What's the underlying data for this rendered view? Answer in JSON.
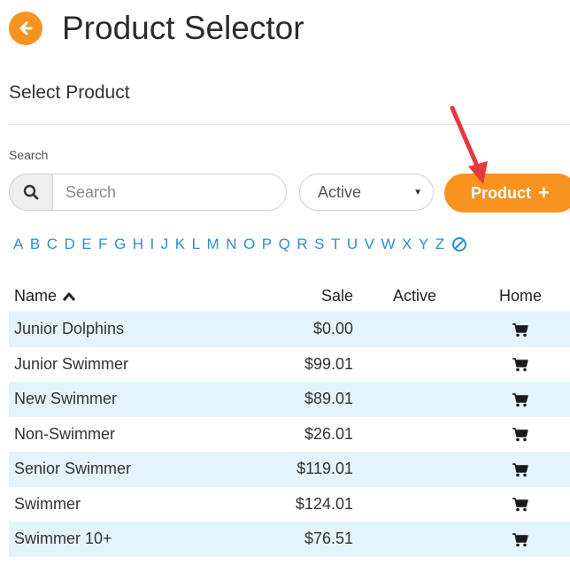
{
  "header": {
    "title": "Product Selector",
    "back_icon": "arrow-left-icon",
    "accent_color": "#f7931e"
  },
  "section": {
    "title": "Select Product"
  },
  "search": {
    "label": "Search",
    "placeholder": "Search",
    "value": "",
    "icon": "search-icon"
  },
  "status_filter": {
    "selected": "Active"
  },
  "add_button": {
    "label": "Product",
    "icon": "plus-icon",
    "color": "#f7931e"
  },
  "alphabet": [
    "A",
    "B",
    "C",
    "D",
    "E",
    "F",
    "G",
    "H",
    "I",
    "J",
    "K",
    "L",
    "M",
    "N",
    "O",
    "P",
    "Q",
    "R",
    "S",
    "T",
    "U",
    "V",
    "W",
    "X",
    "Y",
    "Z"
  ],
  "table": {
    "columns": {
      "name": "Name",
      "sale": "Sale",
      "active": "Active",
      "home": "Home"
    },
    "sort": "name-ascending",
    "row_highlight_color": "#e4f4fc",
    "rows": [
      {
        "name": "Junior Dolphins",
        "sale": "$0.00"
      },
      {
        "name": "Junior Swimmer",
        "sale": "$99.01"
      },
      {
        "name": "New Swimmer",
        "sale": "$89.01"
      },
      {
        "name": "Non-Swimmer",
        "sale": "$26.01"
      },
      {
        "name": "Senior Swimmer",
        "sale": "$119.01"
      },
      {
        "name": "Swimmer",
        "sale": "$124.01"
      },
      {
        "name": "Swimmer 10+",
        "sale": "$76.51"
      }
    ]
  }
}
